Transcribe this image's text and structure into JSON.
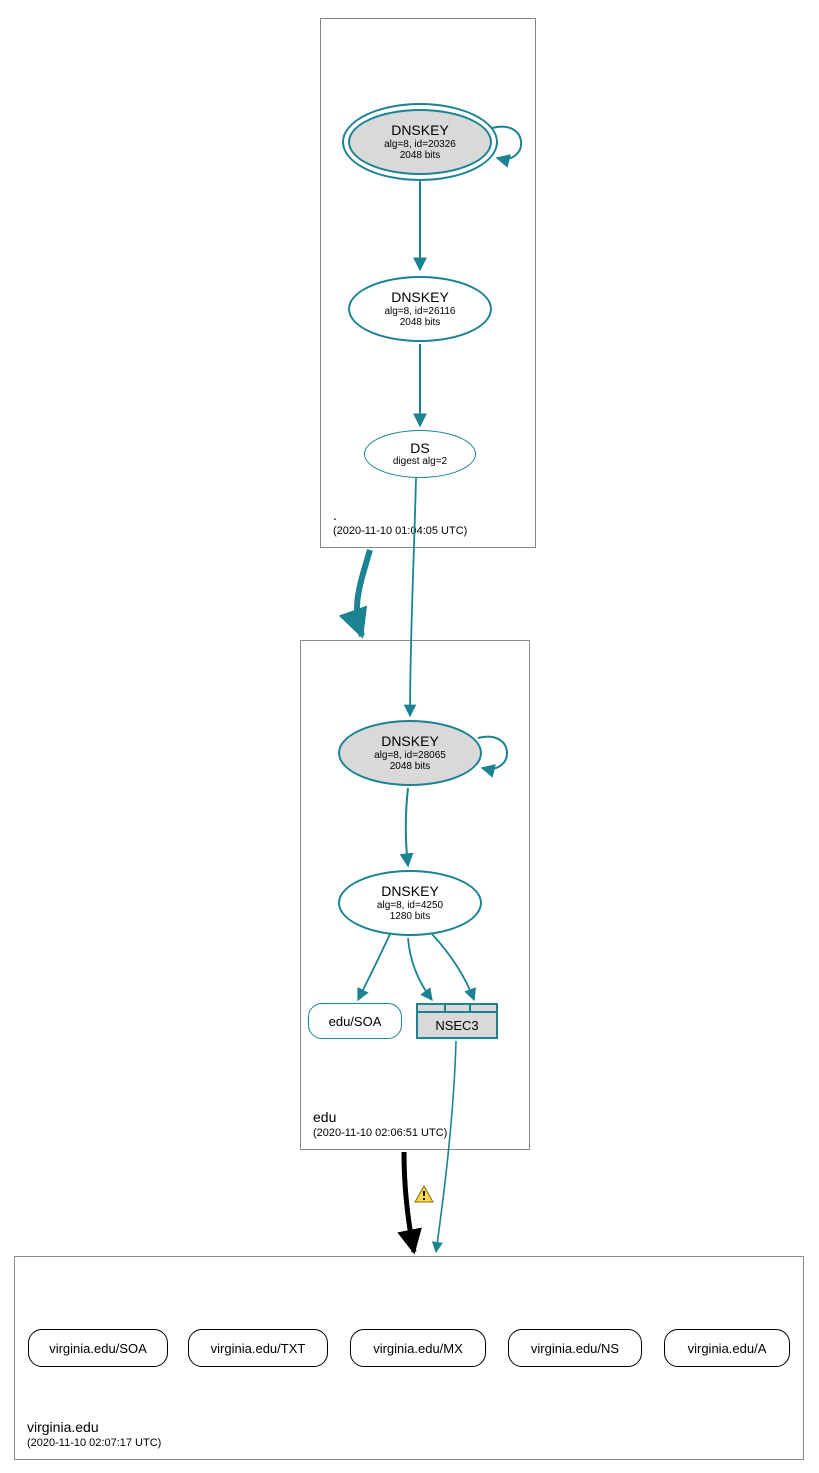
{
  "colors": {
    "teal": "#1b8392",
    "grey_fill": "#d9d9d9",
    "box_border": "#888888",
    "black": "#000000"
  },
  "zones": {
    "root": {
      "name": ".",
      "timestamp": "(2020-11-10 01:04:05 UTC)",
      "ksk": {
        "title": "DNSKEY",
        "line2": "alg=8, id=20326",
        "line3": "2048 bits"
      },
      "zsk": {
        "title": "DNSKEY",
        "line2": "alg=8, id=26116",
        "line3": "2048 bits"
      },
      "ds": {
        "title": "DS",
        "line2": "digest alg=2"
      }
    },
    "edu": {
      "name": "edu",
      "timestamp": "(2020-11-10 02:06:51 UTC)",
      "ksk": {
        "title": "DNSKEY",
        "line2": "alg=8, id=28065",
        "line3": "2048 bits"
      },
      "zsk": {
        "title": "DNSKEY",
        "line2": "alg=8, id=4250",
        "line3": "1280 bits"
      },
      "soa": "edu/SOA",
      "nsec3": "NSEC3"
    },
    "virginia": {
      "name": "virginia.edu",
      "timestamp": "(2020-11-10 02:07:17 UTC)",
      "records": [
        "virginia.edu/SOA",
        "virginia.edu/TXT",
        "virginia.edu/MX",
        "virginia.edu/NS",
        "virginia.edu/A"
      ]
    }
  },
  "warning_icon": "⚠"
}
